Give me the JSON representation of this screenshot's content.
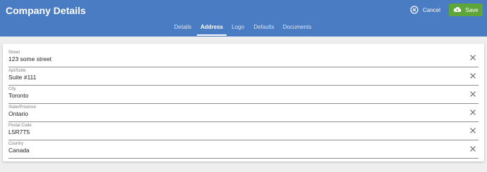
{
  "header": {
    "title": "Company Details",
    "cancel_label": "Cancel",
    "save_label": "Save",
    "cancel_icon": "close-circle-icon",
    "save_icon": "cloud-upload-icon"
  },
  "tabs": [
    {
      "label": "Details"
    },
    {
      "label": "Address",
      "active": true
    },
    {
      "label": "Logo"
    },
    {
      "label": "Defaults"
    },
    {
      "label": "Documents"
    }
  ],
  "fields": [
    {
      "label": "Street",
      "value": "123 some street"
    },
    {
      "label": "Apt/Suite",
      "value": "Suite #111"
    },
    {
      "label": "City",
      "value": "Toronto"
    },
    {
      "label": "State/Province",
      "value": "Ontario"
    },
    {
      "label": "Postal Code",
      "value": "L5R7T5"
    },
    {
      "label": "Country",
      "value": "Canada"
    }
  ],
  "colors": {
    "header": "#4a7cc4",
    "save_button": "#5ea53a",
    "background": "#eeeeee"
  }
}
